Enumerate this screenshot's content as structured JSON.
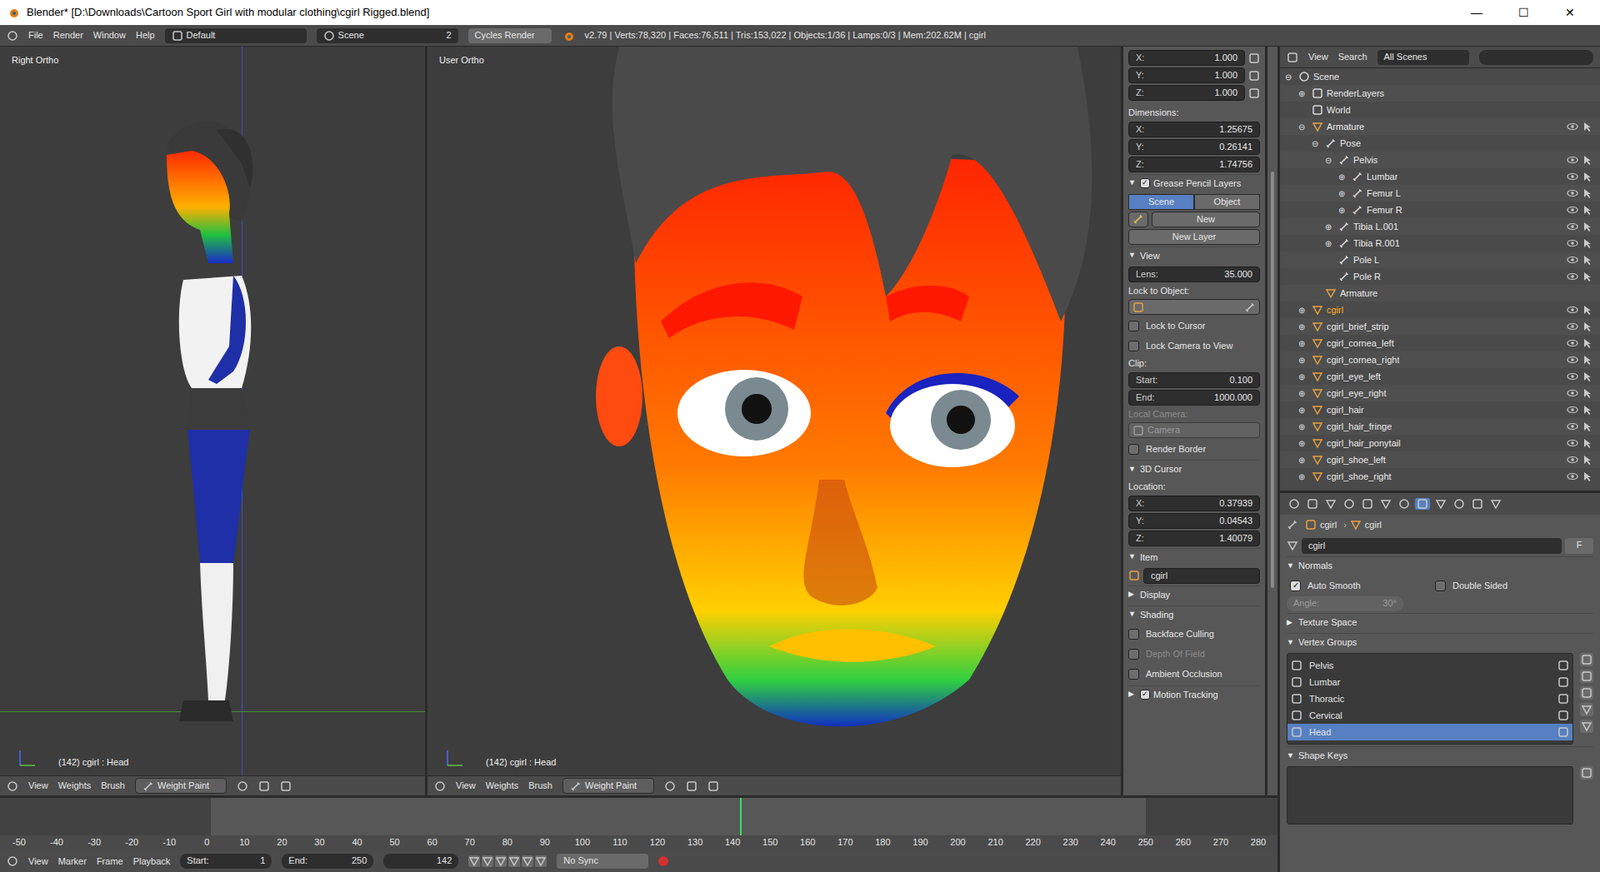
{
  "window": {
    "title": "Blender* [D:\\Downloads\\Cartoon Sport Girl with modular clothing\\cgirl Rigged.blend]",
    "controls": [
      "—",
      "☐",
      "✕"
    ]
  },
  "info_header": {
    "menus": [
      "File",
      "Render",
      "Window",
      "Help"
    ],
    "layout": "Default",
    "scene": "Scene",
    "scene_users": "2",
    "engine": "Cycles Render",
    "stats": "v2.79 | Verts:78,320 | Faces:76,511 | Tris:153,022 | Objects:1/36 | Lamps:0/3 | Mem:202.62M | cgirl"
  },
  "viewports": [
    {
      "label": "Right Ortho",
      "status": "(142) cgirl : Head",
      "menus": [
        "View",
        "Weights",
        "Brush"
      ],
      "mode": "Weight Paint",
      "kind": "side"
    },
    {
      "label": "User Ortho",
      "status": "(142) cgirl : Head",
      "menus": [
        "View",
        "Weights",
        "Brush"
      ],
      "mode": "Weight Paint",
      "kind": "face"
    }
  ],
  "n_panel": {
    "scale": [
      {
        "label": "X:",
        "value": "1.000"
      },
      {
        "label": "Y:",
        "value": "1.000"
      },
      {
        "label": "Z:",
        "value": "1.000"
      }
    ],
    "dimensions_label": "Dimensions:",
    "dimensions": [
      {
        "label": "X:",
        "value": "1.25675"
      },
      {
        "label": "Y:",
        "value": "0.26141"
      },
      {
        "label": "Z:",
        "value": "1.74756"
      }
    ],
    "grease_pencil": {
      "title": "Grease Pencil Layers",
      "checked": true,
      "tabs": [
        {
          "label": "Scene",
          "selected": true
        },
        {
          "label": "Object",
          "selected": false
        }
      ],
      "new": "New",
      "new_layer": "New Layer"
    },
    "view": {
      "title": "View",
      "lens_label": "Lens:",
      "lens": "35.000",
      "lock_to_object": "Lock to Object:",
      "checks": [
        {
          "label": "Lock to Cursor",
          "checked": false
        },
        {
          "label": "Lock Camera to View",
          "checked": false
        }
      ],
      "clip": "Clip:",
      "clip_fields": [
        {
          "label": "Start:",
          "value": "0.100"
        },
        {
          "label": "End:",
          "value": "1000.000"
        }
      ],
      "local_camera": "Local Camera:",
      "camera": "Camera",
      "render_border": {
        "label": "Render Border",
        "checked": false
      }
    },
    "cursor": {
      "title": "3D Cursor",
      "location": "Location:",
      "coords": [
        {
          "label": "X:",
          "value": "0.37939"
        },
        {
          "label": "Y:",
          "value": "0.04543"
        },
        {
          "label": "Z:",
          "value": "1.40079"
        }
      ]
    },
    "item": {
      "title": "Item",
      "name": "cgirl"
    },
    "display": {
      "title": "Display"
    },
    "shading": {
      "title": "Shading",
      "checks": [
        {
          "label": "Backface Culling",
          "checked": false,
          "disabled": false
        },
        {
          "label": "Depth Of Field",
          "checked": false,
          "disabled": true
        },
        {
          "label": "Ambient Occlusion",
          "checked": false,
          "disabled": false
        }
      ]
    },
    "motion_tracking": {
      "title": "Motion Tracking",
      "checked": true
    }
  },
  "outliner": {
    "menus": [
      "View",
      "Search"
    ],
    "filter": "All Scenes",
    "items": [
      {
        "label": "Scene",
        "depth": 0,
        "has_children": true,
        "expanded": true,
        "selected": false,
        "kind": "scene"
      },
      {
        "label": "RenderLayers",
        "depth": 1,
        "has_children": true,
        "expanded": false,
        "selected": false,
        "kind": "renderlayers"
      },
      {
        "label": "World",
        "depth": 1,
        "has_children": false,
        "expanded": false,
        "selected": false,
        "kind": "world"
      },
      {
        "label": "Armature",
        "depth": 1,
        "has_children": true,
        "expanded": true,
        "selected": false,
        "kind": "armature"
      },
      {
        "label": "Pose",
        "depth": 2,
        "has_children": true,
        "expanded": true,
        "selected": false,
        "kind": "pose"
      },
      {
        "label": "Pelvis",
        "depth": 3,
        "has_children": true,
        "expanded": true,
        "selected": false,
        "kind": "bone"
      },
      {
        "label": "Lumbar",
        "depth": 4,
        "has_children": true,
        "expanded": false,
        "selected": false,
        "kind": "bone"
      },
      {
        "label": "Femur L",
        "depth": 4,
        "has_children": true,
        "expanded": false,
        "selected": false,
        "kind": "bone"
      },
      {
        "label": "Femur R",
        "depth": 4,
        "has_children": true,
        "expanded": false,
        "selected": false,
        "kind": "bone"
      },
      {
        "label": "Tibia L.001",
        "depth": 3,
        "has_children": true,
        "expanded": false,
        "selected": false,
        "kind": "bone"
      },
      {
        "label": "Tibia R.001",
        "depth": 3,
        "has_children": true,
        "expanded": false,
        "selected": false,
        "kind": "bone"
      },
      {
        "label": "Pole L",
        "depth": 3,
        "has_children": false,
        "expanded": false,
        "selected": false,
        "kind": "bone"
      },
      {
        "label": "Pole R",
        "depth": 3,
        "has_children": false,
        "expanded": false,
        "selected": false,
        "kind": "bone"
      },
      {
        "label": "Armature",
        "depth": 2,
        "has_children": false,
        "expanded": false,
        "selected": false,
        "kind": "armature_data"
      },
      {
        "label": "cgirl",
        "depth": 1,
        "has_children": true,
        "expanded": false,
        "selected": true,
        "kind": "mesh"
      },
      {
        "label": "cgirl_brief_strip",
        "depth": 1,
        "has_children": true,
        "expanded": false,
        "selected": false,
        "kind": "mesh"
      },
      {
        "label": "cgirl_cornea_left",
        "depth": 1,
        "has_children": true,
        "expanded": false,
        "selected": false,
        "kind": "mesh"
      },
      {
        "label": "cgirl_cornea_right",
        "depth": 1,
        "has_children": true,
        "expanded": false,
        "selected": false,
        "kind": "mesh"
      },
      {
        "label": "cgirl_eye_left",
        "depth": 1,
        "has_children": true,
        "expanded": false,
        "selected": false,
        "kind": "mesh"
      },
      {
        "label": "cgirl_eye_right",
        "depth": 1,
        "has_children": true,
        "expanded": false,
        "selected": false,
        "kind": "mesh"
      },
      {
        "label": "cgirl_hair",
        "depth": 1,
        "has_children": true,
        "expanded": false,
        "selected": false,
        "kind": "mesh"
      },
      {
        "label": "cgirl_hair_fringe",
        "depth": 1,
        "has_children": true,
        "expanded": false,
        "selected": false,
        "kind": "mesh"
      },
      {
        "label": "cgirl_hair_ponytail",
        "depth": 1,
        "has_children": true,
        "expanded": false,
        "selected": false,
        "kind": "mesh"
      },
      {
        "label": "cgirl_shoe_left",
        "depth": 1,
        "has_children": true,
        "expanded": false,
        "selected": false,
        "kind": "mesh"
      },
      {
        "label": "cgirl_shoe_right",
        "depth": 1,
        "has_children": true,
        "expanded": false,
        "selected": false,
        "kind": "mesh"
      }
    ]
  },
  "properties": {
    "breadcrumb": [
      "cgirl",
      "cgirl"
    ],
    "name": "cgirl",
    "fake_user": "F",
    "normals": {
      "title": "Normals",
      "checks": [
        {
          "label": "Auto Smooth",
          "checked": true
        },
        {
          "label": "Double Sided",
          "checked": false
        }
      ],
      "angle_label": "Angle:",
      "angle": "30°"
    },
    "texture_space": {
      "title": "Texture Space"
    },
    "vertex_groups": {
      "title": "Vertex Groups",
      "items": [
        {
          "label": "Pelvis",
          "selected": false
        },
        {
          "label": "Lumbar",
          "selected": false
        },
        {
          "label": "Thoracic",
          "selected": false
        },
        {
          "label": "Cervical",
          "selected": false
        },
        {
          "label": "Head",
          "selected": true
        }
      ]
    },
    "shape_keys": {
      "title": "Shape Keys"
    }
  },
  "timeline": {
    "ticks": [
      "-50",
      "-40",
      "-30",
      "-20",
      "-10",
      "0",
      "10",
      "20",
      "30",
      "40",
      "50",
      "60",
      "70",
      "80",
      "90",
      "100",
      "110",
      "120",
      "130",
      "140",
      "150",
      "160",
      "170",
      "180",
      "190",
      "200",
      "210",
      "220",
      "230",
      "240",
      "250",
      "260",
      "270",
      "280"
    ],
    "menus": [
      "View",
      "Marker",
      "Frame",
      "Playback"
    ],
    "start_label": "Start:",
    "start": "1",
    "end_label": "End:",
    "end": "250",
    "frame": "142",
    "sync": "No Sync"
  }
}
